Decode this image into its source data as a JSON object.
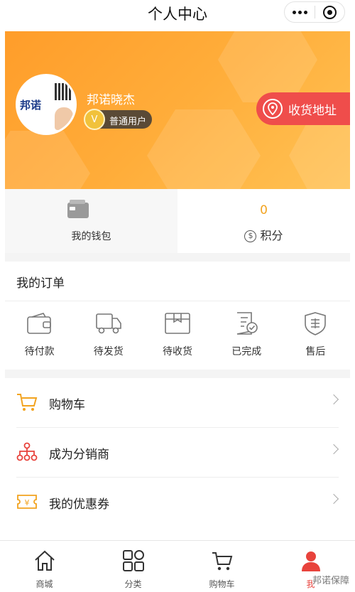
{
  "window": {
    "title": "个人中心"
  },
  "profile": {
    "username": "邦诺晓杰",
    "level": "普通用户",
    "avatar_logo_text": "邦诺",
    "address_button": "收货地址"
  },
  "stats": {
    "wallet_label": "我的钱包",
    "points_value": "0",
    "points_label": "积分",
    "points_icon": "$"
  },
  "orders": {
    "title": "我的订单",
    "items": [
      {
        "label": "待付款",
        "icon": "wallet-icon"
      },
      {
        "label": "待发货",
        "icon": "truck-icon"
      },
      {
        "label": "待收货",
        "icon": "package-icon"
      },
      {
        "label": "已完成",
        "icon": "document-check-icon"
      },
      {
        "label": "售后",
        "icon": "shield-icon"
      }
    ]
  },
  "menu": [
    {
      "label": "购物车",
      "icon": "cart-icon",
      "color": "#f2a31f"
    },
    {
      "label": "成为分销商",
      "icon": "network-icon",
      "color": "#e8433c"
    },
    {
      "label": "我的优惠券",
      "icon": "coupon-icon",
      "color": "#f2a31f"
    }
  ],
  "tabbar": [
    {
      "label": "商城",
      "icon": "home-icon"
    },
    {
      "label": "分类",
      "icon": "grid-icon"
    },
    {
      "label": "购物车",
      "icon": "cart-icon"
    },
    {
      "label": "我",
      "icon": "user-icon",
      "active": true
    }
  ],
  "watermark": "邦诺保障",
  "colors": {
    "accent": "#e8433c",
    "orange": "#f2a31f",
    "banner": "#ffad3a"
  }
}
